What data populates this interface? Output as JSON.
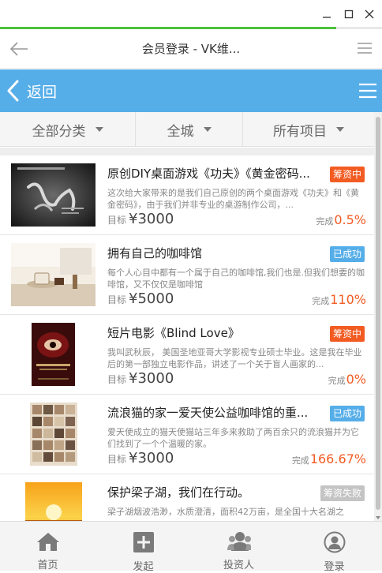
{
  "window": {
    "progress": 0.88
  },
  "address_bar": {
    "title": "会员登录 - VK维..."
  },
  "header": {
    "back_label": "返回"
  },
  "filters": [
    {
      "label": "全部分类"
    },
    {
      "label": "全城"
    },
    {
      "label": "所有项目"
    }
  ],
  "projects": [
    {
      "title": "原创DIY桌面游戏《功夫》《黄金密码...",
      "status": "筹资中",
      "status_color": "#f25b22",
      "desc": "这次给大家带来的是我们自己原创的两个桌面游戏《功夫》和《黄金密码》，由于我们并非专业的桌游制作公司，...",
      "target_label": "目标",
      "target": "¥3000",
      "done_label": "完成",
      "done": "0.5%",
      "thumb": "kungfu"
    },
    {
      "title": "拥有自己的咖啡馆",
      "status": "已成功",
      "status_color": "#56aee9",
      "desc": "每个人心目中都有一个属于自己的咖啡馆,我们也是.但我们想要的咖啡馆，又不仅仅是咖啡馆",
      "target_label": "目标",
      "target": "¥5000",
      "done_label": "完成",
      "done": "110%",
      "thumb": "cafe"
    },
    {
      "title": "短片电影《Blind Love》",
      "status": "筹资中",
      "status_color": "#f25b22",
      "desc": "我叫武秋辰， 美国圣地亚哥大学影视专业硕士毕业。这是我在毕业后的第一部独立电影作品，讲述了一个关于盲人画家的...",
      "target_label": "目标",
      "target": "¥3000",
      "done_label": "完成",
      "done": "0%",
      "thumb": "poster"
    },
    {
      "title": "流浪猫的家一爱天使公益咖啡馆的重...",
      "status": "已成功",
      "status_color": "#56aee9",
      "desc": "爱天使成立的猫天使猫站三年多来救助了两百余只的流浪猫并为它们找到了一个个温暖的家。",
      "target_label": "目标",
      "target": "¥3000",
      "done_label": "完成",
      "done": "166.67%",
      "thumb": "cats"
    },
    {
      "title": "保护梁子湖，我们在行动。",
      "status": "筹资失败",
      "status_color": "#c4c4c4",
      "desc": "梁子湖烟波浩渺，水质澄清，面积42万亩，是全国十大名湖之",
      "target_label": "",
      "target": "",
      "done_label": "",
      "done": "",
      "thumb": "sunset"
    }
  ],
  "tabs": [
    {
      "label": "首页",
      "icon": "home-icon"
    },
    {
      "label": "发起",
      "icon": "plus-box-icon"
    },
    {
      "label": "投资人",
      "icon": "people-icon"
    },
    {
      "label": "登录",
      "icon": "user-icon"
    }
  ]
}
